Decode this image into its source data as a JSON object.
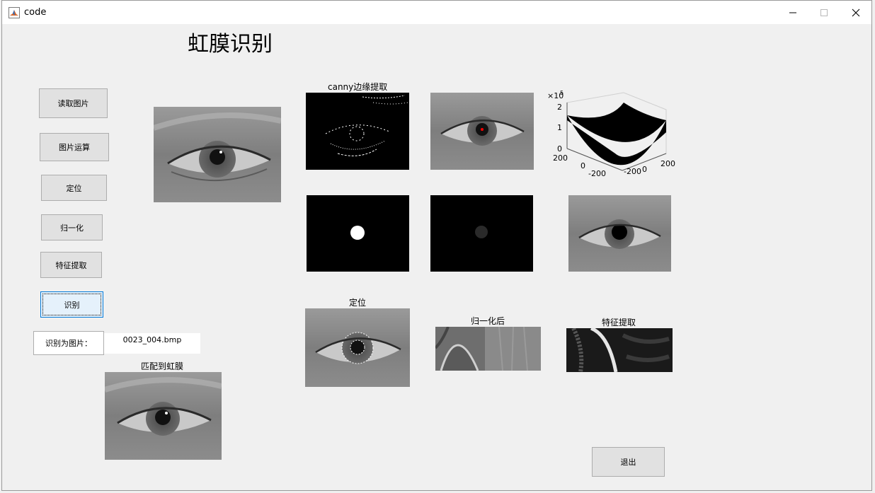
{
  "window": {
    "title": "code"
  },
  "app": {
    "heading": "虹膜识别"
  },
  "buttons": {
    "read_image": "读取图片",
    "image_ops": "图片运算",
    "locate": "定位",
    "normalize": "归一化",
    "feature": "特征提取",
    "recognize": "识别",
    "exit": "退出"
  },
  "result": {
    "label": "识别为图片：",
    "value": "0023_004.bmp"
  },
  "captions": {
    "canny": "canny边缘提取",
    "locate": "定位",
    "normalized": "归一化后",
    "feature": "特征提取",
    "matched": "匹配到虹膜"
  },
  "plot3d": {
    "exponent_label": "×10",
    "exponent_power": "5",
    "z_ticks": [
      "2",
      "1",
      "0"
    ],
    "y_ticks": [
      "200",
      "0",
      "-200"
    ],
    "x_ticks": [
      "-200",
      "0",
      "200"
    ]
  },
  "colors": {
    "focus_border": "#0078d7",
    "pupil_marker": "#ff0000"
  },
  "icons": [
    "matlab-icon",
    "minimize-icon",
    "maximize-icon",
    "close-icon"
  ]
}
